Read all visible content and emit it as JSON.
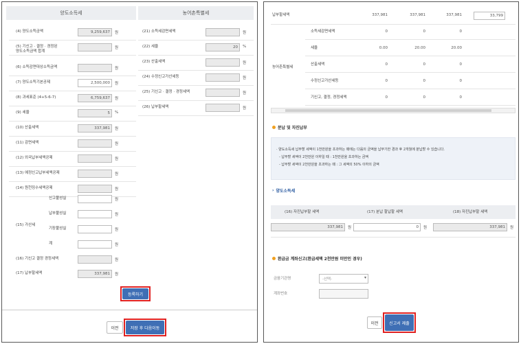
{
  "left": {
    "headers": {
      "capital_gains": "양도소득세",
      "rural_tax": "농어촌특별세"
    },
    "rows": [
      {
        "label": "(4) 양도소득금액",
        "value": "9,259,637",
        "unit": "원",
        "gray": true
      },
      {
        "label": "(5) 기신고 · 결정 · 경정된\n양도소득금액 합계",
        "value": "",
        "unit": "원",
        "gray": true
      },
      {
        "label": "(6) 소득감면대상소득금액",
        "value": "",
        "unit": "원",
        "gray": true
      },
      {
        "label": "(7) 양도소득기본공제",
        "value": "2,500,000",
        "unit": "원",
        "gray": false
      },
      {
        "label": "(8) 과세표준 (4+5-6-7)",
        "value": "6,759,637",
        "unit": "원",
        "gray": true
      },
      {
        "label": "(9) 세율",
        "value": "5",
        "unit": "%",
        "gray": true
      },
      {
        "label": "(10) 산출세액",
        "value": "337,981",
        "unit": "원",
        "gray": true
      },
      {
        "label": "(11) 감면세액",
        "value": "",
        "unit": "원",
        "gray": true
      },
      {
        "label": "(12) 외국납부세액공제",
        "value": "",
        "unit": "원",
        "gray": true
      },
      {
        "label": "(13) 예정신고납부세액공제",
        "value": "",
        "unit": "원",
        "gray": true
      },
      {
        "label": "(14) 원천징수세액공제",
        "value": "",
        "unit": "원",
        "gray": true
      }
    ],
    "penalty": {
      "group_label": "(15) 가산세",
      "items": [
        {
          "label": "신고불성실",
          "value": "",
          "unit": "원"
        },
        {
          "label": "납부불성실",
          "value": "",
          "unit": "원"
        },
        {
          "label": "기장불성실",
          "value": "",
          "unit": "원"
        },
        {
          "label": "계",
          "value": "",
          "unit": "원"
        }
      ]
    },
    "rows_tail": [
      {
        "label": "(16) 기신고 결정 경정세액",
        "value": "",
        "unit": "원",
        "gray": true
      },
      {
        "label": "(17) 납부할세액",
        "value": "337,981",
        "unit": "원",
        "gray": true
      }
    ],
    "right_rows": [
      {
        "label": "(21) 소득세감면세액",
        "value": "",
        "unit": "원"
      },
      {
        "label": "(22) 세율",
        "value": "20",
        "unit": "%"
      },
      {
        "label": "(23) 산출세액",
        "value": "",
        "unit": "원"
      },
      {
        "label": "(24) 수정신고가산세등",
        "value": "",
        "unit": "원"
      },
      {
        "label": "(25) 기신고 · 결정 · 경정세액",
        "value": "",
        "unit": "원"
      },
      {
        "label": "(26) 납부할세액",
        "value": "",
        "unit": "원"
      }
    ],
    "register_button": "등록하기",
    "prev_button": "이전",
    "save_next_button": "저장 후 다음이동"
  },
  "right": {
    "top_row": {
      "label": "납부할세액",
      "values": [
        "337,981",
        "337,981",
        "337,981",
        "33,799"
      ]
    },
    "rural_group_label": "농어촌특별세",
    "rural_rows": [
      {
        "label": "소득세감면세액",
        "values": [
          "0",
          "0",
          "0"
        ]
      },
      {
        "label": "세율",
        "values": [
          "0.00",
          "20.00",
          "20.00"
        ]
      },
      {
        "label": "산출세액",
        "values": [
          "0",
          "0",
          "0"
        ]
      },
      {
        "label": "수정신고가산세등",
        "values": [
          "0",
          "0",
          "0"
        ]
      },
      {
        "label": "기신고, 결정, 경정세액",
        "values": [
          "0",
          "0",
          "0"
        ]
      }
    ],
    "installment": {
      "title": "분납 및 자진납부",
      "notes": [
        "· 양도소득세 납부할 세액이 1천만원을 초과하는 때에는 다음의 금액을 납부기한 경과 후 2개월에 분납할 수 있습니다.",
        "- 납부할 세액이 2천만원 이하일 때 : 1천만원을 초과하는 금액",
        "- 납부할 세액이 2천만원을 초과하는 때 : 그 세액의 50% 이하의 금액"
      ]
    },
    "cg_link": "양도소득세",
    "cols": [
      "(16) 자진납부할 세액",
      "(17) 분납 할납할 세액",
      "(18) 자진납부할 세액"
    ],
    "col_values": [
      "337,981",
      "0",
      "337,981"
    ],
    "unit": "원",
    "refund": {
      "title": "환급금 계좌신고(환급세액 2천만원 미만인 경우)",
      "bank_label": "금융기관명",
      "bank_select": "-선택-",
      "account_label": "계좌번호"
    },
    "prev_button": "이전",
    "submit_button": "신고서 제출"
  }
}
